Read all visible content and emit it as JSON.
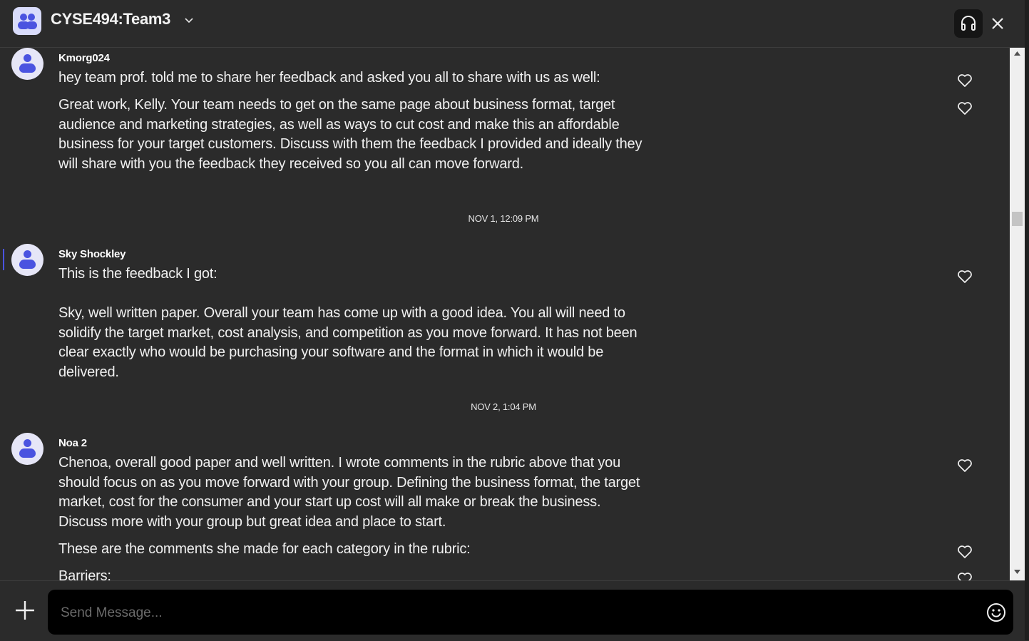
{
  "header": {
    "title": "CYSE494:Team3",
    "icons": {
      "group": "group-chat-icon",
      "dropdown": "chevron-down-icon",
      "audio": "headset-icon",
      "close": "close-icon"
    }
  },
  "messages": [
    {
      "author": "Kmorg024",
      "paragraphs": [
        "hey team prof. told me to share her feedback and asked you all to share with us as well:",
        "Great work, Kelly. Your team needs to get on the same page about business format, target audience and marketing strategies, as well as ways to cut cost and make this an affordable business for your target customers. Discuss with them the feedback I provided and ideally they will share with you the feedback they received so you all can move forward."
      ]
    },
    {
      "timestamp": "NOV 1, 12:09 PM",
      "author": "Sky Shockley",
      "paragraphs": [
        "This is the feedback I got:\n\nSky, well written paper. Overall your team has come up with a good idea. You all will need to solidify the target market, cost analysis, and competition as you move forward. It has not been clear exactly who would be purchasing your software and the format in which it would be delivered."
      ]
    },
    {
      "timestamp": "NOV 2, 1:04 PM",
      "author": "Noa 2",
      "paragraphs": [
        "Chenoa, overall good paper and well written. I wrote comments in the rubric above that you should focus on as you move forward with your group. Defining the business format, the target market, cost for the consumer and your start up cost will all make or break the business. Discuss more with your group but great idea and place to start.",
        "These are the comments she made for each category in the rubric:",
        "Barriers:"
      ]
    }
  ],
  "composer": {
    "placeholder": "Send Message...",
    "icons": {
      "add": "plus-icon",
      "emoji": "emoji-icon"
    }
  }
}
